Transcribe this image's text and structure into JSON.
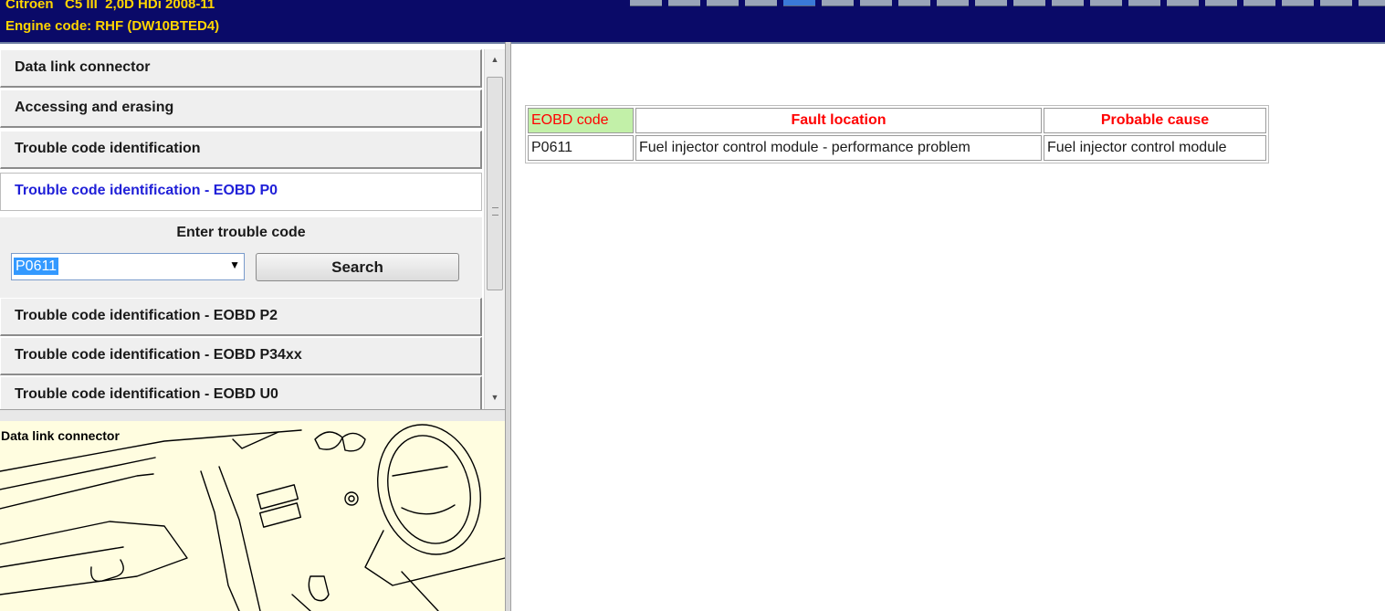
{
  "header": {
    "vehicle": "Citroen   C5 III  2,0D HDi 2008-11",
    "engine": "Engine code: RHF (DW10BTED4)"
  },
  "colors": {
    "header_bg": "#0a0a68",
    "header_text": "#ffd500",
    "active_nav_text": "#2020d8",
    "table_header_text": "#ff0000",
    "code_header_bg": "#c2f0a8",
    "image_bg": "#fffde0"
  },
  "nav": {
    "items": [
      {
        "label": "Data link connector"
      },
      {
        "label": "Accessing and erasing"
      },
      {
        "label": "Trouble code identification"
      },
      {
        "label": "Trouble code identification - EOBD P0"
      },
      {
        "label": "Trouble code identification - EOBD P2"
      },
      {
        "label": "Trouble code identification - EOBD P34xx"
      },
      {
        "label": "Trouble code identification - EOBD U0"
      }
    ],
    "active_index": 3
  },
  "search": {
    "title": "Enter trouble code",
    "value": "P0611",
    "button_label": "Search"
  },
  "image": {
    "label": "Data link connector"
  },
  "table": {
    "headers": [
      "EOBD code",
      "Fault location",
      "Probable cause"
    ],
    "rows": [
      [
        "P0611",
        "Fuel injector control module - performance problem",
        "Fuel injector control module"
      ]
    ]
  },
  "icons": {
    "scroll_up": "scroll-up-arrow-icon",
    "scroll_down": "scroll-down-arrow-icon",
    "combo": "chevron-down-icon"
  }
}
